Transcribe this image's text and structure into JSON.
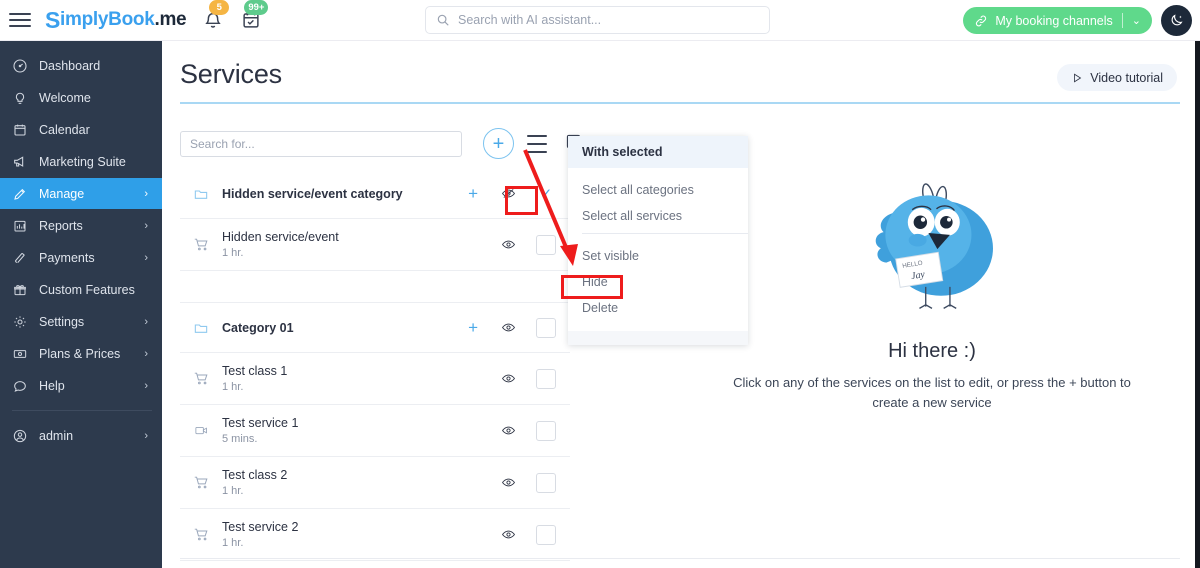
{
  "topbar": {
    "menu_icon": "hamburger-icon",
    "logo": {
      "s": "S",
      "blue_part": "implyBook",
      "dark_part": ".me"
    },
    "bell_icon": "bell-icon",
    "bell_badge": "5",
    "calendar_icon": "calendar-check-icon",
    "calendar_badge": "99+",
    "search": {
      "placeholder": "Search with AI assistant...",
      "value": "",
      "icon": "search-icon"
    },
    "booking_button": {
      "label": "My booking channels",
      "icon": "link-icon",
      "caret": "⌄",
      "color": "#5fd98b"
    },
    "theme_toggle": {
      "icon": "moon-icon",
      "color": "#1d2939"
    }
  },
  "sidebar": {
    "bg_color": "#2d3a4d",
    "active_color": "#2f9fe8",
    "items": [
      {
        "label": "Dashboard",
        "icon": "dashboard-icon",
        "chevron": "",
        "active": false
      },
      {
        "label": "Welcome",
        "icon": "bulb-icon",
        "chevron": "",
        "active": false
      },
      {
        "label": "Calendar",
        "icon": "calendar-icon",
        "chevron": "",
        "active": false
      },
      {
        "label": "Marketing Suite",
        "icon": "megaphone-icon",
        "chevron": "",
        "active": false
      },
      {
        "label": "Manage",
        "icon": "pencil-icon",
        "chevron": "›",
        "active": true
      },
      {
        "label": "Reports",
        "icon": "bar-chart-icon",
        "chevron": "›",
        "active": false
      },
      {
        "label": "Payments",
        "icon": "payments-icon",
        "chevron": "›",
        "active": false
      },
      {
        "label": "Custom Features",
        "icon": "gift-icon",
        "chevron": "",
        "active": false
      },
      {
        "label": "Settings",
        "icon": "gear-icon",
        "chevron": "›",
        "active": false
      },
      {
        "label": "Plans & Prices",
        "icon": "money-icon",
        "chevron": "›",
        "active": false
      },
      {
        "label": "Help",
        "icon": "chat-bubble-icon",
        "chevron": "›",
        "active": false
      }
    ],
    "account": {
      "label": "admin",
      "icon": "user-circle-icon",
      "chevron": "›"
    }
  },
  "main": {
    "title": "Services",
    "video_button": {
      "label": "Video tutorial",
      "icon": "play-icon"
    },
    "toolbar": {
      "search": {
        "placeholder": "Search for...",
        "value": ""
      },
      "add_button": {
        "label": "+",
        "icon": "plus-icon"
      },
      "list_menu_icon": "hamburger-list-icon",
      "select_all_icon": "checkbox-checked-icon"
    },
    "list": [
      {
        "type": "category",
        "name": "Hidden service/event category",
        "duration": "",
        "icon": "folder-icon",
        "plus": "+",
        "eye": "eye-hidden-icon",
        "selector": "check",
        "highlighted": true
      },
      {
        "type": "service",
        "name": "Hidden service/event",
        "duration": "1 hr.",
        "icon": "cart-icon",
        "plus": "",
        "eye": "eye-icon",
        "selector": "checkbox",
        "highlighted": false
      },
      {
        "type": "spacer",
        "name": "",
        "duration": "",
        "icon": "",
        "plus": "",
        "eye": "",
        "selector": "none",
        "highlighted": false
      },
      {
        "type": "category",
        "name": "Category 01",
        "duration": "",
        "icon": "folder-icon",
        "plus": "+",
        "eye": "eye-icon",
        "selector": "checkbox",
        "highlighted": false
      },
      {
        "type": "service",
        "name": "Test class 1",
        "duration": "1 hr.",
        "icon": "cart-icon",
        "plus": "",
        "eye": "eye-icon",
        "selector": "checkbox",
        "highlighted": false
      },
      {
        "type": "service",
        "name": "Test service 1",
        "duration": "5 mins.",
        "icon": "video-icon",
        "plus": "",
        "eye": "eye-icon",
        "selector": "checkbox",
        "highlighted": false
      },
      {
        "type": "service",
        "name": "Test class 2",
        "duration": "1 hr.",
        "icon": "cart-icon",
        "plus": "",
        "eye": "eye-icon",
        "selector": "checkbox",
        "highlighted": false
      },
      {
        "type": "service",
        "name": "Test service 2",
        "duration": "1 hr.",
        "icon": "cart-icon",
        "plus": "",
        "eye": "eye-icon",
        "selector": "checkbox",
        "highlighted": false
      }
    ],
    "dropdown": {
      "header": "With selected",
      "group1": [
        "Select all categories",
        "Select all services"
      ],
      "group2": [
        "Set visible",
        "Hide",
        "Delete"
      ],
      "highlighted_item": "Hide"
    },
    "empty_state": {
      "illustration": "blue-bird-mascot",
      "badge_hello": "HELLO",
      "badge_name": "Jay",
      "heading": "Hi there :)",
      "text": "Click on any of the services on the list to edit, or press the + button to create a new service"
    },
    "annotation": {
      "arrow_color": "#ee1c1c",
      "box_color": "#ee1c1c"
    }
  }
}
